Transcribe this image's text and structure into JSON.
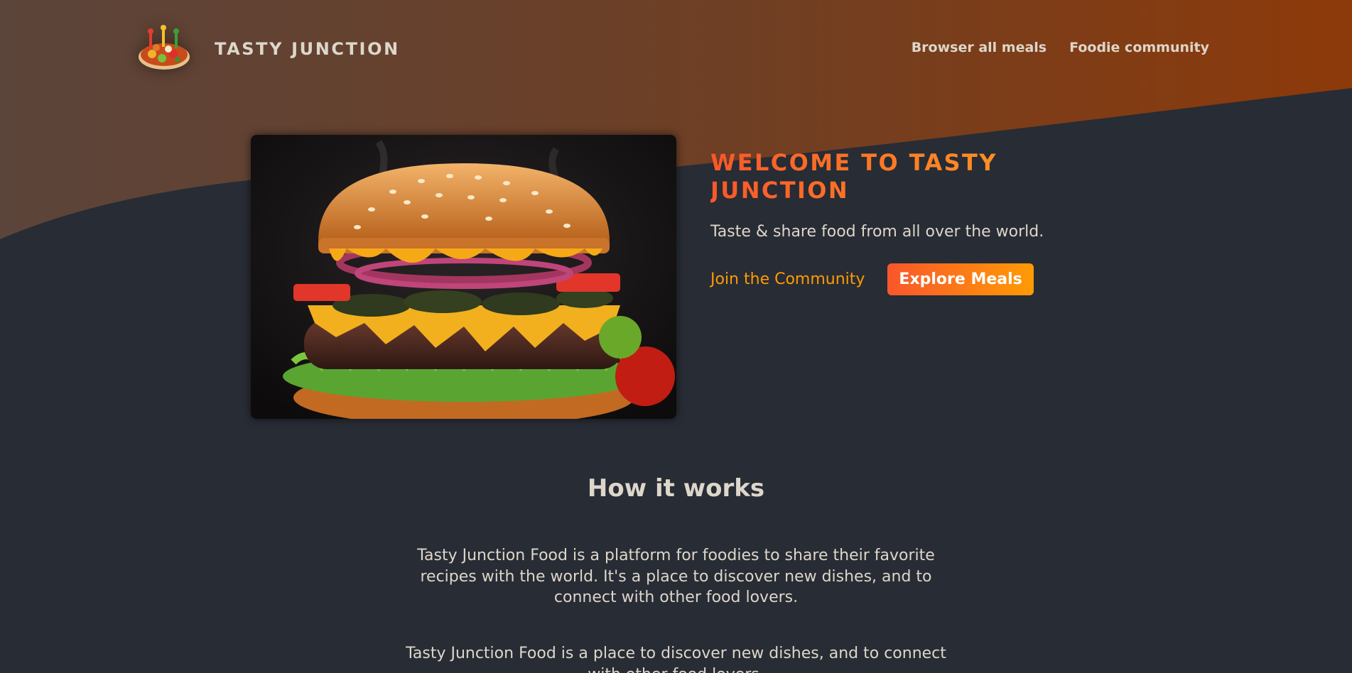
{
  "header": {
    "logo_text": "TASTY JUNCTION",
    "logo_icon": "food-plate-logo",
    "nav": [
      {
        "label": "Browser all meals"
      },
      {
        "label": "Foodie community"
      }
    ]
  },
  "hero": {
    "image_icon": "burger-photo",
    "title": "WELCOME TO TASTY JUNCTION",
    "subtitle": "Taste & share food from all over the world.",
    "join_link": "Join the Community",
    "explore_button": "Explore Meals"
  },
  "how": {
    "title": "How it works",
    "p1": "Tasty Junction Food is a platform for foodies to share their favorite recipes with the world. It's a place to discover new dishes, and to connect with other food lovers.",
    "p2": "Tasty Junction Food is a place to discover new dishes, and to connect with other food lovers."
  },
  "colors": {
    "background": "#282c34",
    "text": "#ddd6cb",
    "accent_start": "#f9572a",
    "accent_end": "#ff9b05",
    "header_gradient_start": "#5f4338",
    "header_gradient_end": "#8a3a0c"
  }
}
